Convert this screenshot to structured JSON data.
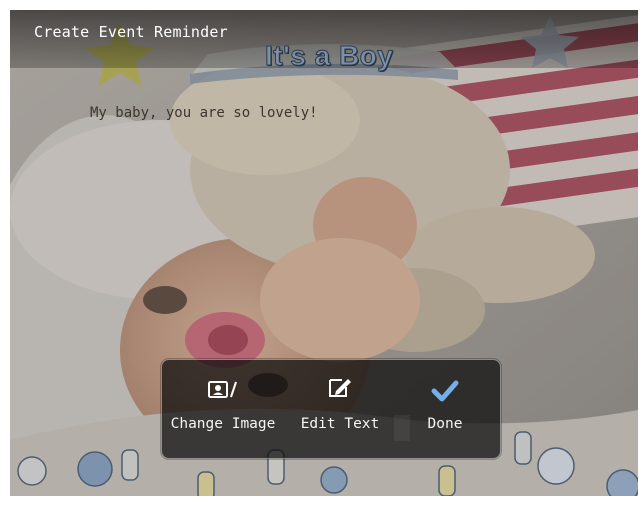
{
  "header": {
    "title": "Create Event Reminder"
  },
  "template": {
    "banner_text": "It's a Boy",
    "caption": "My baby, you are so lovely!"
  },
  "menu": {
    "change_image_label": "Change Image",
    "edit_text_label": "Edit Text",
    "done_label": "Done"
  },
  "icons": {
    "change_image": "change-image-icon",
    "edit_text": "edit-text-icon",
    "done": "checkmark-icon"
  },
  "colors": {
    "accent": "#76aee8",
    "text": "#f4f4f4",
    "menu_background": "#0a0a0a"
  }
}
